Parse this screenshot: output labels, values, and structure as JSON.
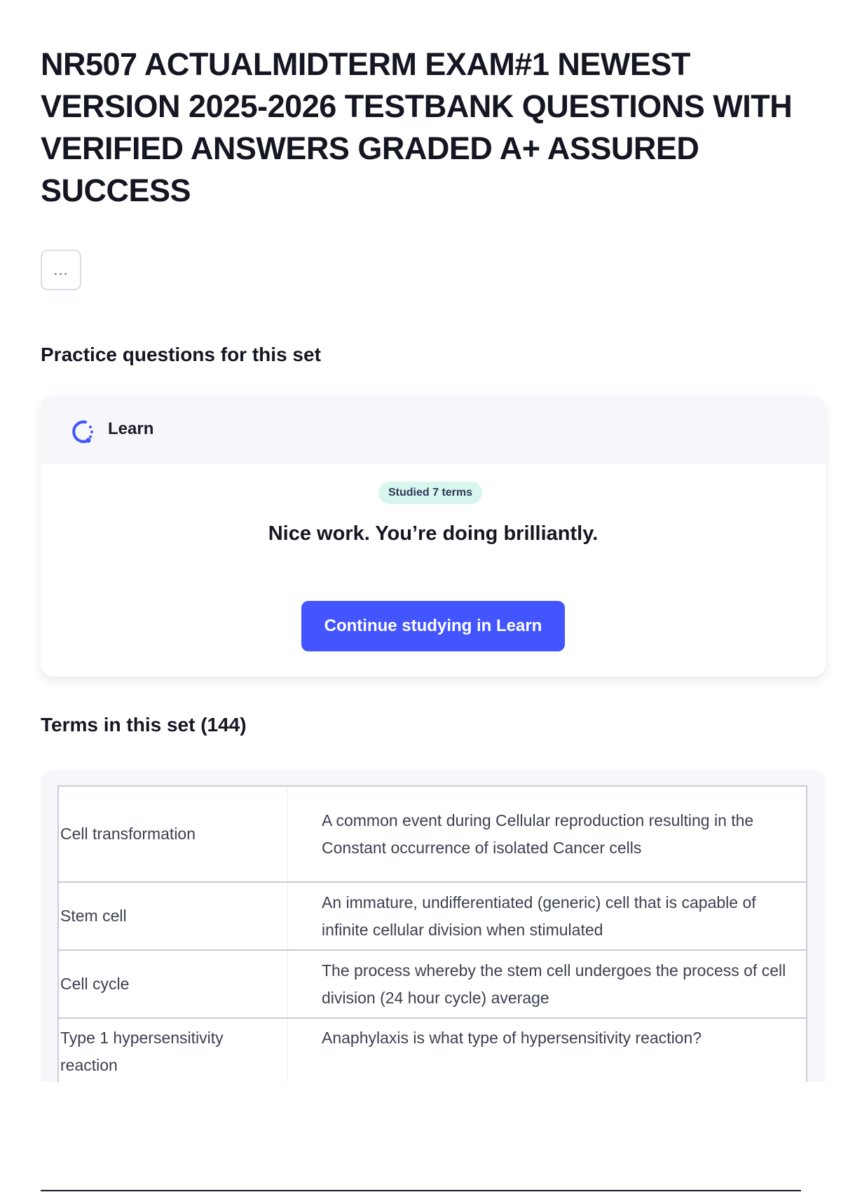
{
  "title": "NR507 ACTUALMIDTERM EXAM#1 NEWEST VERSION 2025-2026 TESTBANK QUESTIONS WITH VERIFIED ANSWERS GRADED A+ ASSURED SUCCESS",
  "more_button": {
    "label": "...",
    "icon": "more-options-icon"
  },
  "practice": {
    "heading": "Practice questions for this set",
    "learn_card": {
      "icon": "learn-progress-icon",
      "label": "Learn",
      "badge": "Studied 7 terms",
      "message": "Nice work. You’re doing brilliantly.",
      "button_label": "Continue studying in Learn"
    }
  },
  "terms": {
    "heading": "Terms in this set (144)",
    "rows": [
      {
        "term": "Cell transformation",
        "definition": "A common event during Cellular reproduction resulting in the Constant occurrence of isolated Cancer cells"
      },
      {
        "term": "Stem cell",
        "definition": "An immature, undifferentiated (generic) cell that is capable of infinite cellular division when stimulated"
      },
      {
        "term": "Cell cycle",
        "definition": "The process whereby the stem cell undergoes the process of cell division (24 hour cycle) average"
      },
      {
        "term": "Type 1 hypersensitivity reaction",
        "definition": "Anaphylaxis is what type of hypersensitivity reaction?"
      }
    ]
  },
  "colors": {
    "accent": "#4255ff",
    "badge_bg": "#d7f6ee",
    "card_header_bg": "#f6f7fb",
    "text": "#141722"
  }
}
